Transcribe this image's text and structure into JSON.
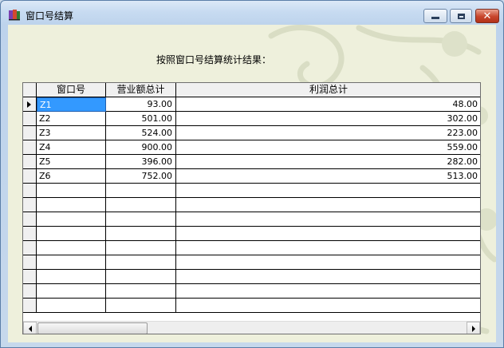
{
  "window": {
    "title": "窗口号结算"
  },
  "heading": "按照窗口号结算统计结果：",
  "grid": {
    "columns": [
      "窗口号",
      "营业额总计",
      "利润总计"
    ],
    "rows": [
      [
        "Z1",
        "93.00",
        "48.00"
      ],
      [
        "Z2",
        "501.00",
        "302.00"
      ],
      [
        "Z3",
        "524.00",
        "223.00"
      ],
      [
        "Z4",
        "900.00",
        "559.00"
      ],
      [
        "Z5",
        "396.00",
        "282.00"
      ],
      [
        "Z6",
        "752.00",
        "513.00"
      ]
    ],
    "empty_rows": 9,
    "selected_row": 0
  },
  "icons": {
    "app": "app-window-icon",
    "minimize": "minimize-icon",
    "maximize": "maximize-icon",
    "close": "close-icon"
  }
}
